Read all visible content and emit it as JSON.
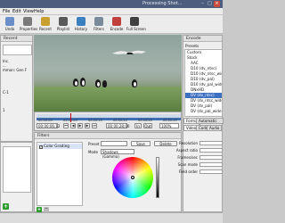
{
  "window": {
    "title": "Processing Shot..."
  },
  "menu": [
    "File",
    "Edit",
    "View",
    "Help"
  ],
  "toolbar": [
    {
      "label": "Undo",
      "icon": "undo-icon",
      "color": "#6a8fc8"
    },
    {
      "label": "Properties",
      "icon": "properties-icon",
      "color": "#7a7a7a"
    },
    {
      "label": "Recent",
      "icon": "recent-icon",
      "color": "#c8a030"
    },
    {
      "label": "Playlist",
      "icon": "playlist-icon",
      "color": "#5a5a5a"
    },
    {
      "label": "History",
      "icon": "history-icon",
      "color": "#3c7fc0"
    },
    {
      "label": "Filters",
      "icon": "filters-icon",
      "color": "#7a8a9a"
    },
    {
      "label": "Encode",
      "icon": "encode-icon",
      "color": "#c04040"
    },
    {
      "label": "Full Screen",
      "icon": "fullscreen-icon",
      "color": "#404040"
    }
  ],
  "left_panel": {
    "header": "Recent",
    "lines": [
      "Inc.",
      "...",
      "mmon: Gen F",
      "",
      "",
      "",
      "",
      "C-1",
      "",
      "",
      "",
      "1",
      "",
      "",
      "",
      "",
      ""
    ]
  },
  "timeline": {
    "ticks": [
      "00:00:00",
      "00:00:05",
      "00:00:10",
      "00:00:15",
      "00:00:20",
      "00:00:25"
    ],
    "current": "00:00:06;12",
    "duration": "00:00:28;00",
    "zoom": "100%",
    "in_label": "In",
    "out_label": "Out",
    "mute_label": "Mute"
  },
  "filters": {
    "header": "Filters",
    "items": [
      {
        "label": "Color Grading",
        "checked": true
      }
    ],
    "preset_label": "Preset",
    "save_label": "Save",
    "delete_label": "Delete",
    "mode_label": "Mode",
    "mode_value": "Shadows (Gamma)"
  },
  "encode": {
    "header": "Encode",
    "presets_label": "Presets",
    "tree": [
      {
        "label": "Custom",
        "hl": false
      },
      {
        "label": "Stock",
        "hl": false
      },
      {
        "label": "AAC",
        "hl": false
      },
      {
        "label": "D10 (dv_ntsc)",
        "hl": false
      },
      {
        "label": "D10 (dv_ntsc_wide)",
        "hl": false
      },
      {
        "label": "D10 (dv_pal)",
        "hl": false
      },
      {
        "label": "D10 (dv_pal_wide)",
        "hl": false
      },
      {
        "label": "DNxHD",
        "hl": false
      },
      {
        "label": "DV (dv_ntsc)",
        "hl": true
      },
      {
        "label": "DV (dv_ntsc_wide)",
        "hl": false
      },
      {
        "label": "DV (dv_pal)",
        "hl": false
      },
      {
        "label": "DV (dv_pal_wide)",
        "hl": false
      }
    ],
    "tabs": [
      "Format",
      "Automatic Format",
      "Video",
      "Codec",
      "Audio"
    ],
    "video_props": [
      {
        "k": "Resolution"
      },
      {
        "k": "Aspect ratio"
      },
      {
        "k": "Frames/sec"
      },
      {
        "k": "Scan mode"
      },
      {
        "k": "Field order"
      }
    ]
  }
}
